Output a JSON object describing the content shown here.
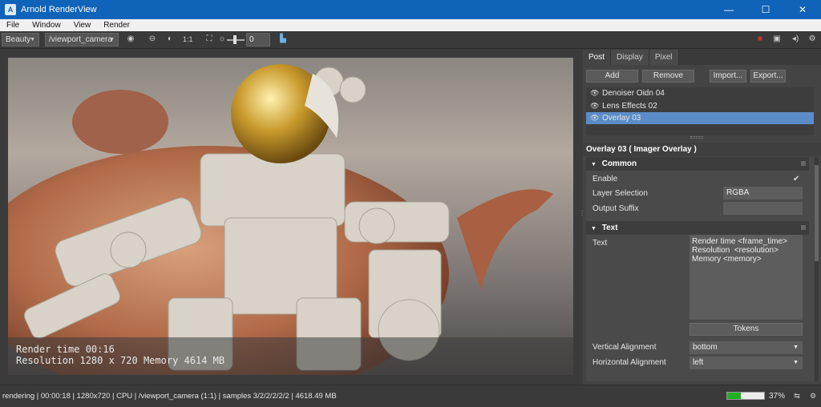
{
  "window": {
    "title": "Arnold RenderView",
    "minimize": "—",
    "maximize": "☐",
    "close": "✕"
  },
  "menu": [
    "File",
    "Window",
    "View",
    "Render"
  ],
  "toolbar": {
    "aov": "Beauty",
    "camera": "/viewport_camera",
    "ratio_label": "1:1",
    "exposure": "0"
  },
  "render": {
    "overlay_line1": "Render time 00:16",
    "overlay_line2": "Resolution  1280 x 720 Memory 4614 MB"
  },
  "panel": {
    "tabs": [
      "Post",
      "Display",
      "Pixel"
    ],
    "active_tab": "Post",
    "buttons": {
      "add": "Add",
      "remove": "Remove",
      "import": "Import...",
      "export": "Export..."
    },
    "layers": [
      {
        "name": "Denoiser Oidn 04",
        "selected": false
      },
      {
        "name": "Lens Effects 02",
        "selected": false
      },
      {
        "name": "Overlay 03",
        "selected": true
      }
    ],
    "section_title": "Overlay 03  ( Imager Overlay )",
    "common": {
      "header": "Common",
      "enable_label": "Enable",
      "enable_checked": true,
      "layer_selection_label": "Layer Selection",
      "layer_selection_value": "RGBA",
      "output_suffix_label": "Output Suffix",
      "output_suffix_value": ""
    },
    "text": {
      "header": "Text",
      "text_label": "Text",
      "text_value": "Render time <frame_time>\nResolution  <resolution> Memory <memory>",
      "tokens_button": "Tokens",
      "vertical_alignment_label": "Vertical Alignment",
      "vertical_alignment_value": "bottom",
      "horizontal_alignment_label": "Horizontal Alignment",
      "horizontal_alignment_value": "left"
    }
  },
  "status": {
    "text": "rendering | 00:00:18 | 1280x720 | CPU | /viewport_camera (1:1) | samples 3/2/2/2/2/2 | 4618.49 MB",
    "progress": 0.37,
    "progress_label": "37%"
  },
  "colors": {
    "accent": "#0f63b8",
    "selection": "#5b8cc8",
    "progress": "#20b020"
  }
}
